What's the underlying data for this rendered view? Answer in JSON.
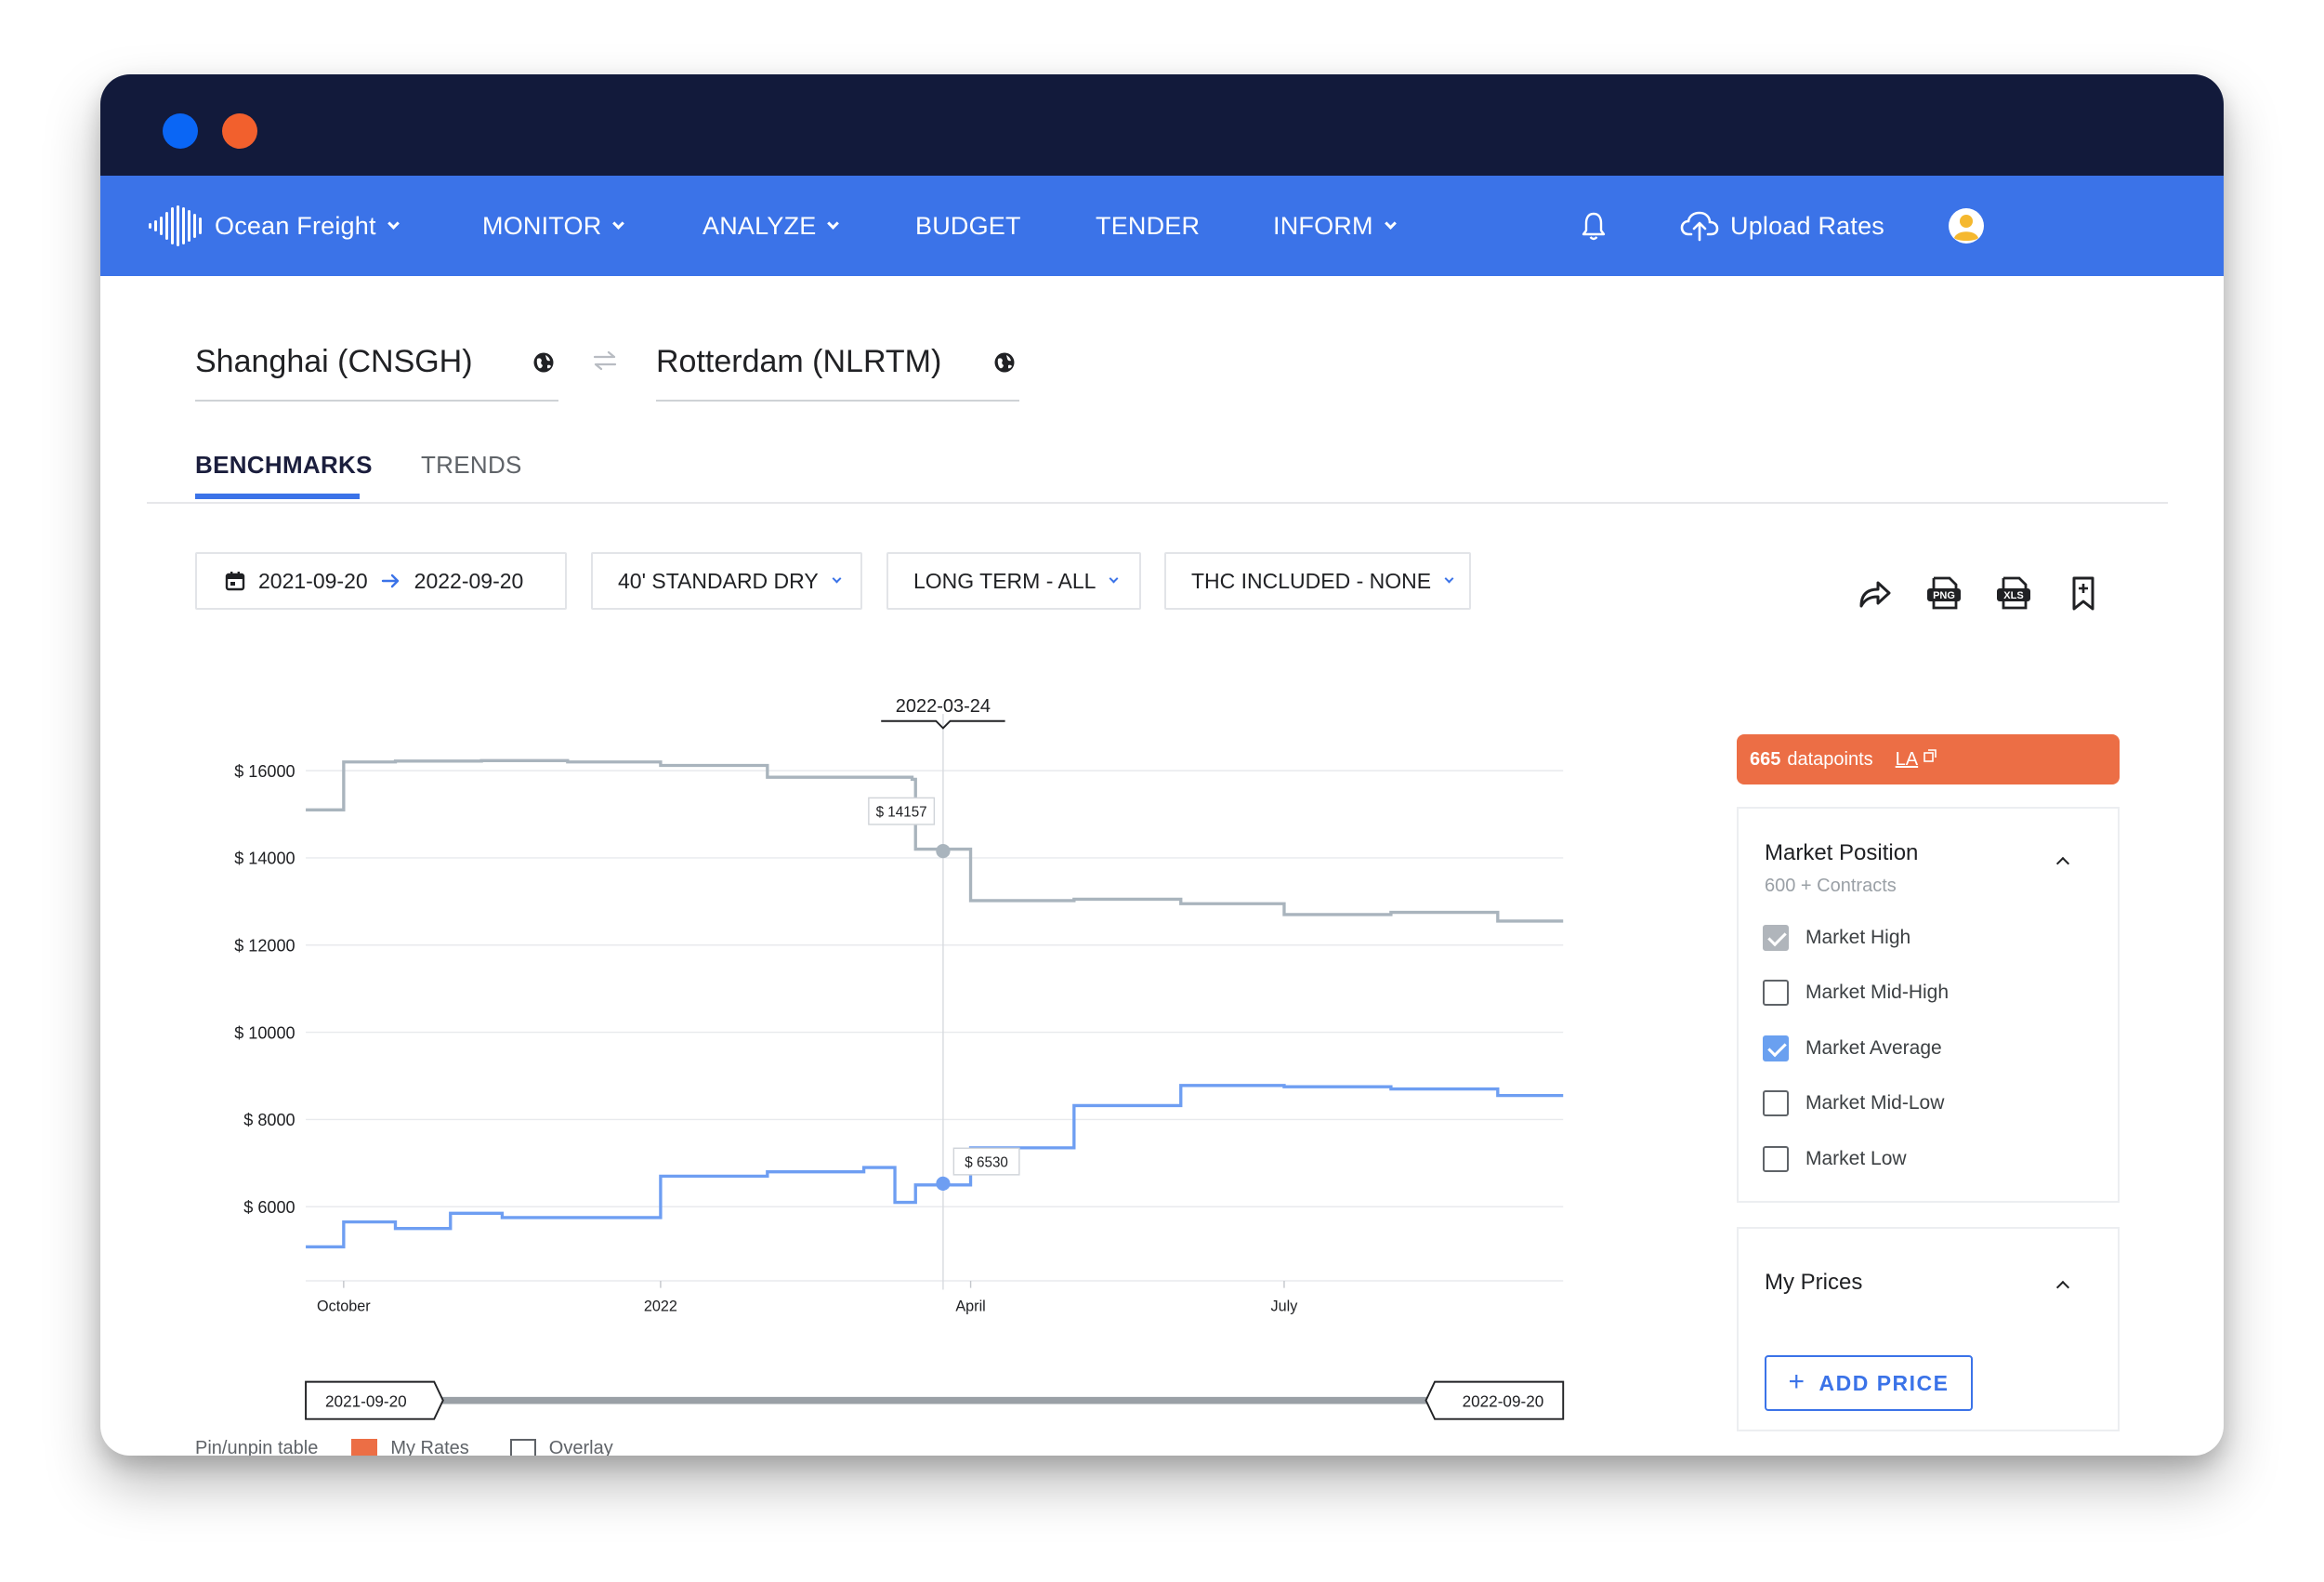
{
  "nav": {
    "brand": "Ocean Freight",
    "monitor": "MONITOR",
    "analyze": "ANALYZE",
    "budget": "BUDGET",
    "tender": "TENDER",
    "inform": "INFORM",
    "upload": "Upload Rates",
    "icons": [
      "waveform-logo-icon",
      "bell-icon",
      "cloud-upload-icon",
      "avatar-icon"
    ]
  },
  "route": {
    "origin": "Shanghai (CNSGH)",
    "destination": "Rotterdam (NLRTM)"
  },
  "tabs": {
    "benchmarks": "BENCHMARKS",
    "trends": "TRENDS"
  },
  "filters": {
    "date_from": "2021-09-20",
    "date_to": "2022-09-20",
    "equipment": "40' STANDARD DRY",
    "contract": "LONG TERM - ALL",
    "thc": "THC INCLUDED - NONE"
  },
  "toolbar": {
    "icons": [
      "share-icon",
      "png-export-icon",
      "xls-export-icon",
      "bookmark-icon"
    ]
  },
  "colors": {
    "nav_bg": "#3b73e8",
    "titlebar_bg": "#121a3b",
    "accent_orange": "#ec6e45",
    "series_high": "#a9b4bd",
    "series_avg": "#6e9ef2"
  },
  "datapoints": {
    "count": "665",
    "label": "datapoints",
    "link": "LA"
  },
  "market_position": {
    "title": "Market Position",
    "subtitle": "600 + Contracts",
    "options": [
      {
        "label": "Market High",
        "checked": true
      },
      {
        "label": "Market Mid-High",
        "checked": false
      },
      {
        "label": "Market Average",
        "checked": true
      },
      {
        "label": "Market Mid-Low",
        "checked": false
      },
      {
        "label": "Market Low",
        "checked": false
      }
    ]
  },
  "my_prices": {
    "title": "My Prices",
    "add_label": "ADD PRICE"
  },
  "chart_data": {
    "type": "line",
    "x_ticks": [
      "October",
      "2022",
      "April",
      "July"
    ],
    "y_ticks": [
      "$ 16000",
      "$ 14000",
      "$ 12000",
      "$ 10000",
      "$ 8000",
      "$ 6000"
    ],
    "ylim": [
      4300,
      17300
    ],
    "grid": true,
    "hover_date": "2022-03-24",
    "range_start": "2021-09-20",
    "range_end": "2022-09-20",
    "series": [
      {
        "name": "Market High",
        "color": "#a9b4bd",
        "hover_label": "$ 14157",
        "hover_value": 14157,
        "points": [
          [
            "2021-09-20",
            15100
          ],
          [
            "2021-10-01",
            16200
          ],
          [
            "2021-10-16",
            16220
          ],
          [
            "2021-11-10",
            16230
          ],
          [
            "2021-12-05",
            16200
          ],
          [
            "2022-01-01",
            16120
          ],
          [
            "2022-02-01",
            15850
          ],
          [
            "2022-03-15",
            15800
          ],
          [
            "2022-03-16",
            14200
          ],
          [
            "2022-04-01",
            13020
          ],
          [
            "2022-05-01",
            13050
          ],
          [
            "2022-06-01",
            12950
          ],
          [
            "2022-07-01",
            12700
          ],
          [
            "2022-08-01",
            12750
          ],
          [
            "2022-09-01",
            12550
          ],
          [
            "2022-09-20",
            12550
          ]
        ]
      },
      {
        "name": "Market Average",
        "color": "#6e9ef2",
        "hover_label": "$ 6530",
        "hover_value": 6530,
        "points": [
          [
            "2021-09-20",
            5080
          ],
          [
            "2021-10-01",
            5650
          ],
          [
            "2021-10-16",
            5500
          ],
          [
            "2021-11-01",
            5850
          ],
          [
            "2021-11-16",
            5750
          ],
          [
            "2022-01-01",
            6700
          ],
          [
            "2022-02-01",
            6800
          ],
          [
            "2022-03-01",
            6900
          ],
          [
            "2022-03-10",
            6100
          ],
          [
            "2022-03-16",
            6500
          ],
          [
            "2022-04-01",
            7350
          ],
          [
            "2022-05-01",
            8320
          ],
          [
            "2022-06-01",
            8780
          ],
          [
            "2022-07-01",
            8750
          ],
          [
            "2022-08-01",
            8700
          ],
          [
            "2022-09-01",
            8550
          ],
          [
            "2022-09-20",
            8550
          ]
        ]
      }
    ]
  },
  "legend_partial": {
    "pin_label": "Pin/unpin table",
    "my_rates": "My Rates",
    "overlay": "Overlay"
  }
}
